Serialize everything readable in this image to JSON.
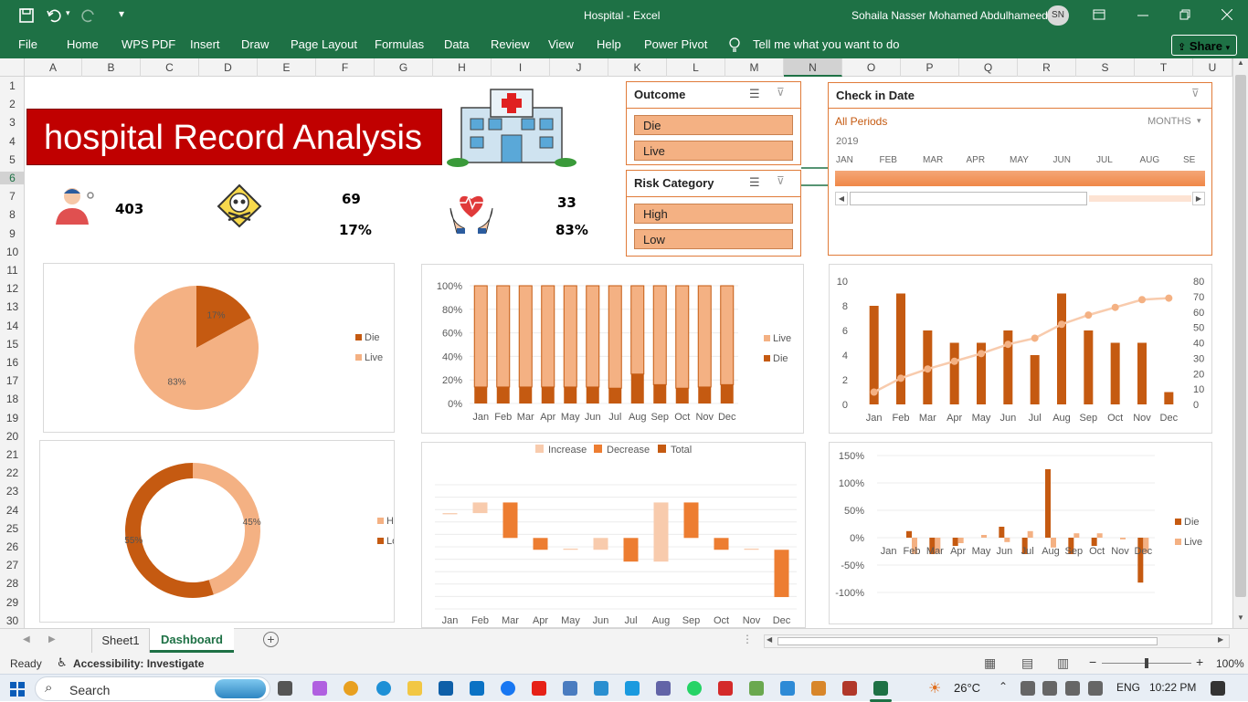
{
  "window": {
    "title": "Hospital  -  Excel",
    "user_name": "Sohaila Nasser Mohamed Abdulhameed",
    "user_initials": "SN"
  },
  "ribbon": {
    "tabs": [
      "File",
      "Home",
      "WPS PDF",
      "Insert",
      "Draw",
      "Page Layout",
      "Formulas",
      "Data",
      "Review",
      "View",
      "Help",
      "Power Pivot"
    ],
    "tell_me": "Tell me what you want to do",
    "share": "Share"
  },
  "grid": {
    "columns": [
      "A",
      "B",
      "C",
      "D",
      "E",
      "F",
      "G",
      "H",
      "I",
      "J",
      "K",
      "L",
      "M",
      "N",
      "O",
      "P",
      "Q",
      "R",
      "S",
      "T",
      "U"
    ],
    "rows": [
      "1",
      "2",
      "3",
      "4",
      "5",
      "6",
      "7",
      "8",
      "9",
      "10",
      "11",
      "12",
      "13",
      "14",
      "15",
      "16",
      "17",
      "18",
      "19",
      "20",
      "21",
      "22",
      "23",
      "24",
      "25",
      "26",
      "27",
      "28",
      "29",
      "30"
    ]
  },
  "dashboard": {
    "banner_title": "hospital Record Analysis",
    "kpis": {
      "total": "403",
      "deaths": "69",
      "deaths_pct": "17%",
      "live": "33",
      "live_pct": "83%"
    }
  },
  "slicers": {
    "outcome": {
      "title": "Outcome",
      "items": [
        "Die",
        "Live"
      ]
    },
    "risk": {
      "title": "Risk Category",
      "items": [
        "High",
        "Low"
      ]
    },
    "timeline": {
      "title": "Check in Date",
      "period_label": "All Periods",
      "level": "MONTHS",
      "year": "2019",
      "months": [
        "JAN",
        "FEB",
        "MAR",
        "APR",
        "MAY",
        "JUN",
        "JUL",
        "AUG",
        "SE"
      ]
    }
  },
  "colors": {
    "dark": "#c55a11",
    "mid": "#ed7d31",
    "light": "#f4b183",
    "lighter": "#f8cbad",
    "excel_green": "#1e7145",
    "banner_red": "#c00000"
  },
  "chart_data": [
    {
      "type": "pie",
      "title": "",
      "labels": [
        "Die",
        "Live"
      ],
      "values": [
        17,
        83
      ],
      "data_labels": [
        "17%",
        "83%"
      ],
      "legend": "right"
    },
    {
      "type": "bar",
      "stacked_percent": true,
      "categories": [
        "Jan",
        "Feb",
        "Mar",
        "Apr",
        "May",
        "Jun",
        "Jul",
        "Aug",
        "Sep",
        "Oct",
        "Nov",
        "Dec"
      ],
      "series": [
        {
          "name": "Live",
          "values": [
            86,
            86,
            86,
            86,
            86,
            86,
            87,
            75,
            84,
            87,
            86,
            84
          ]
        },
        {
          "name": "Die",
          "values": [
            14,
            14,
            14,
            14,
            14,
            14,
            13,
            25,
            16,
            13,
            14,
            16
          ]
        }
      ],
      "y_ticks": [
        "0%",
        "20%",
        "40%",
        "60%",
        "80%",
        "100%"
      ],
      "legend": "right"
    },
    {
      "type": "bar",
      "combo": "bar-line",
      "categories": [
        "Jan",
        "Feb",
        "Mar",
        "Apr",
        "May",
        "Jun",
        "Jul",
        "Aug",
        "Sep",
        "Oct",
        "Nov",
        "Dec"
      ],
      "series": [
        {
          "values": [
            8,
            9,
            6,
            5,
            5,
            6,
            4,
            9,
            6,
            5,
            5,
            1
          ],
          "axis": "left"
        },
        {
          "values": [
            8,
            17,
            23,
            28,
            33,
            39,
            43,
            52,
            58,
            63,
            68,
            69
          ],
          "axis": "right"
        }
      ],
      "ylim_left": [
        0,
        10
      ],
      "ylim_right": [
        0,
        80
      ],
      "left_ticks": [
        "0",
        "2",
        "4",
        "6",
        "8",
        "10"
      ],
      "right_ticks": [
        "0",
        "10",
        "20",
        "30",
        "40",
        "50",
        "60",
        "70",
        "80"
      ]
    },
    {
      "type": "pie",
      "donut": true,
      "labels": [
        "High",
        "Low"
      ],
      "values": [
        45,
        55
      ],
      "data_labels": [
        "45%",
        "55%"
      ],
      "legend": "right"
    },
    {
      "type": "bar",
      "waterfall": true,
      "categories": [
        "Jan",
        "Feb",
        "Mar",
        "Apr",
        "May",
        "Jun",
        "Jul",
        "Aug",
        "Sep",
        "Oct",
        "Nov",
        "Dec"
      ],
      "legend_entries": [
        "Increase",
        "Decrease",
        "Total"
      ],
      "bars": [
        {
          "start": 8,
          "end": 8.1
        },
        {
          "start": 8.1,
          "end": 9
        },
        {
          "start": 9,
          "end": 6
        },
        {
          "start": 6,
          "end": 5
        },
        {
          "start": 5,
          "end": 5.1
        },
        {
          "start": 5,
          "end": 6
        },
        {
          "start": 6,
          "end": 4
        },
        {
          "start": 4,
          "end": 9
        },
        {
          "start": 9,
          "end": 6
        },
        {
          "start": 6,
          "end": 5
        },
        {
          "start": 5,
          "end": 5.1
        },
        {
          "start": 5,
          "end": 1
        }
      ],
      "bar_kind": [
        "increase",
        "increase",
        "decrease",
        "decrease",
        "increase",
        "increase",
        "decrease",
        "increase",
        "decrease",
        "decrease",
        "increase",
        "decrease"
      ]
    },
    {
      "type": "bar",
      "categories": [
        "Jan",
        "Feb",
        "Mar",
        "Apr",
        "May",
        "Jun",
        "Jul",
        "Aug",
        "Sep",
        "Oct",
        "Nov",
        "Dec"
      ],
      "series": [
        {
          "name": "Die",
          "values": [
            0,
            12,
            -30,
            -15,
            0,
            20,
            -30,
            125,
            -30,
            -15,
            0,
            -82
          ]
        },
        {
          "name": "Live",
          "values": [
            0,
            -30,
            -28,
            -10,
            5,
            -8,
            12,
            -18,
            8,
            8,
            -3,
            -28
          ]
        }
      ],
      "y_ticks": [
        "-100%",
        "-50%",
        "0%",
        "50%",
        "100%",
        "150%"
      ],
      "ylim": [
        -100,
        150
      ],
      "legend": "right"
    }
  ],
  "sheet_tabs": [
    "Sheet1",
    "Dashboard"
  ],
  "status": {
    "ready": "Ready",
    "accessibility": "Accessibility: Investigate",
    "zoom": "100%"
  },
  "taskbar": {
    "search": "Search",
    "weather": "26°C",
    "lang": "ENG",
    "time": "10:22 PM"
  }
}
